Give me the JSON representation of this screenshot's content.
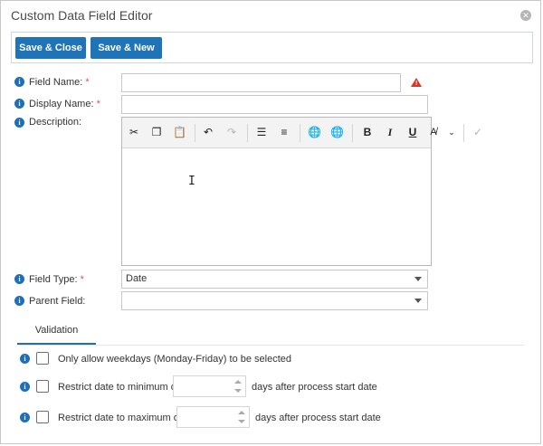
{
  "window": {
    "title": "Custom Data Field Editor"
  },
  "toolbar": {
    "save_close_label": "Save & Close",
    "save_new_label": "Save & New"
  },
  "fields": {
    "field_name": {
      "label": "Field Name:",
      "required_mark": "*",
      "value": ""
    },
    "display_name": {
      "label": "Display Name:",
      "required_mark": "*",
      "value": ""
    },
    "description": {
      "label": "Description:"
    },
    "field_type": {
      "label": "Field Type:",
      "required_mark": "*",
      "value": "Date"
    },
    "parent_field": {
      "label": "Parent Field:",
      "value": ""
    }
  },
  "editor_toolbar": {
    "icons": [
      "cut-icon",
      "copy-icon",
      "paste-icon",
      "undo-icon",
      "redo-icon",
      "numbered-list-icon",
      "bullet-list-icon",
      "insert-link-icon",
      "remove-link-icon",
      "bold-icon",
      "italic-icon",
      "underline-icon",
      "font-color-icon",
      "dropdown-icon",
      "spellcheck-icon"
    ],
    "bold": "B",
    "italic": "I",
    "underline": "U"
  },
  "tabs": {
    "validation_label": "Validation"
  },
  "validation": {
    "weekdays_label": "Only allow weekdays (Monday-Friday) to be selected",
    "min_label": "Restrict date to minimum of",
    "min_suffix": "days after process start date",
    "max_label": "Restrict date to maximum of",
    "max_suffix": "days after process start date"
  },
  "colors": {
    "accent": "#1e6fb6",
    "button": "#1f73b7",
    "warning": "#d9362b"
  }
}
